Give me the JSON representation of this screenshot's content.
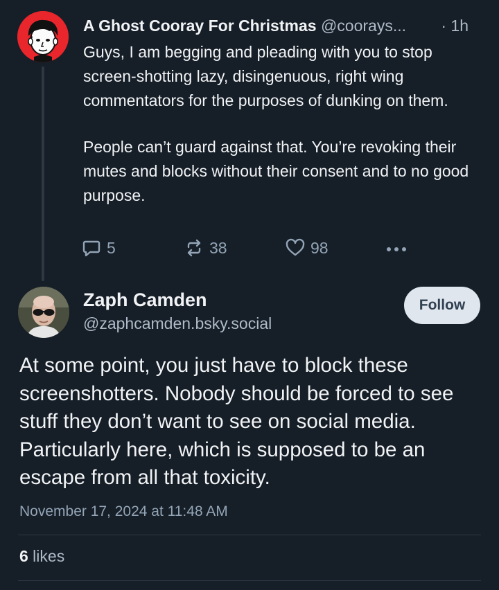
{
  "parent_post": {
    "author_name": "A Ghost Cooray For Christmas",
    "author_handle": "@coorays...",
    "time": "· 1h",
    "avatar_icon": "cartoon-face-avatar",
    "paragraphs": [
      "Guys, I am begging and pleading with you to stop screen-shotting lazy, disingenuous, right wing commentators for the purposes of dunking on them.",
      "People can’t guard against that. You’re revoking their mutes and blocks without their consent and to no good purpose."
    ],
    "actions": {
      "reply_count": "5",
      "repost_count": "38",
      "like_count": "98"
    }
  },
  "main_post": {
    "author_name": "Zaph Camden",
    "author_handle": "@zaphcamden.bsky.social",
    "avatar_icon": "photo-avatar",
    "follow_label": "Follow",
    "text": "At some point, you just have to block these screenshotters. Nobody should be forced to see stuff they don’t want to see on social media. Particularly here, which is supposed to be an escape from all that toxicity.",
    "date": "November 17, 2024 at 11:48 AM",
    "likes_count": "6",
    "likes_label": " likes"
  },
  "colors": {
    "background": "#161e27",
    "text": "#f1f3f5",
    "muted": "#aebbc9",
    "follow_bg": "#dfe6ee"
  }
}
